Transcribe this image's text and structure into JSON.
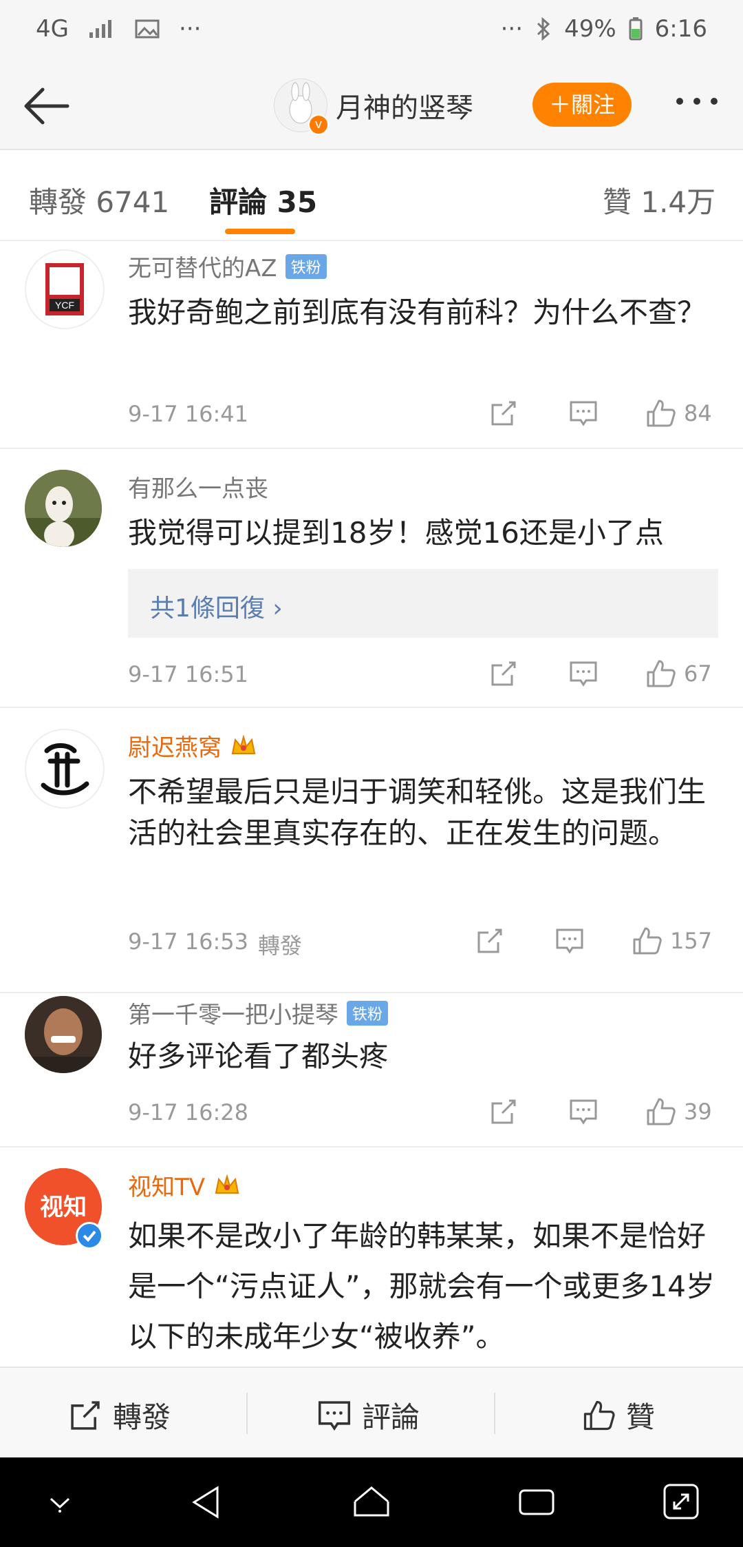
{
  "status_bar": {
    "network": "4G",
    "dots_left": "···",
    "dots_right": "···",
    "battery": "49%",
    "time": "6:16"
  },
  "header": {
    "title": "月神的竖琴",
    "follow_label": "＋關注"
  },
  "tabs": {
    "repost": "轉發 6741",
    "comment": "評論 35",
    "like": "贊 1.4万"
  },
  "comments": [
    {
      "user": "无可替代的AZ",
      "tag": "铁粉",
      "text": "我好奇鲍之前到底有没有前科？为什么不查？",
      "time": "9-17 16:41",
      "likes": "84"
    },
    {
      "user": "有那么一点丧",
      "text": "我觉得可以提到18岁！感觉16还是小了点",
      "reply": "共1條回復 ›",
      "time": "9-17 16:51",
      "likes": "67"
    },
    {
      "user": "尉迟燕窝",
      "text": "不希望最后只是归于调笑和轻佻。这是我们生活的社会里真实存在的、正在发生的问题。",
      "time": "9-17 16:53",
      "extra": "轉發",
      "likes": "157"
    },
    {
      "user": "第一千零一把小提琴",
      "tag": "铁粉",
      "text": "好多评论看了都头疼",
      "time": "9-17 16:28",
      "likes": "39"
    },
    {
      "user": "视知TV",
      "text": "如果不是改小了年龄的韩某某，如果不是恰好是一个“污点证人”，那就会有一个或更多14岁以下的未成年少女“被收养”。"
    }
  ],
  "avatars": {
    "c1": "YCF",
    "c5": "视知"
  },
  "bottom_bar": {
    "repost": "轉發",
    "comment": "評論",
    "like": "贊"
  },
  "colors": {
    "accent": "#ff8200",
    "link": "#5a7db0",
    "vip_name": "#e86a10"
  }
}
